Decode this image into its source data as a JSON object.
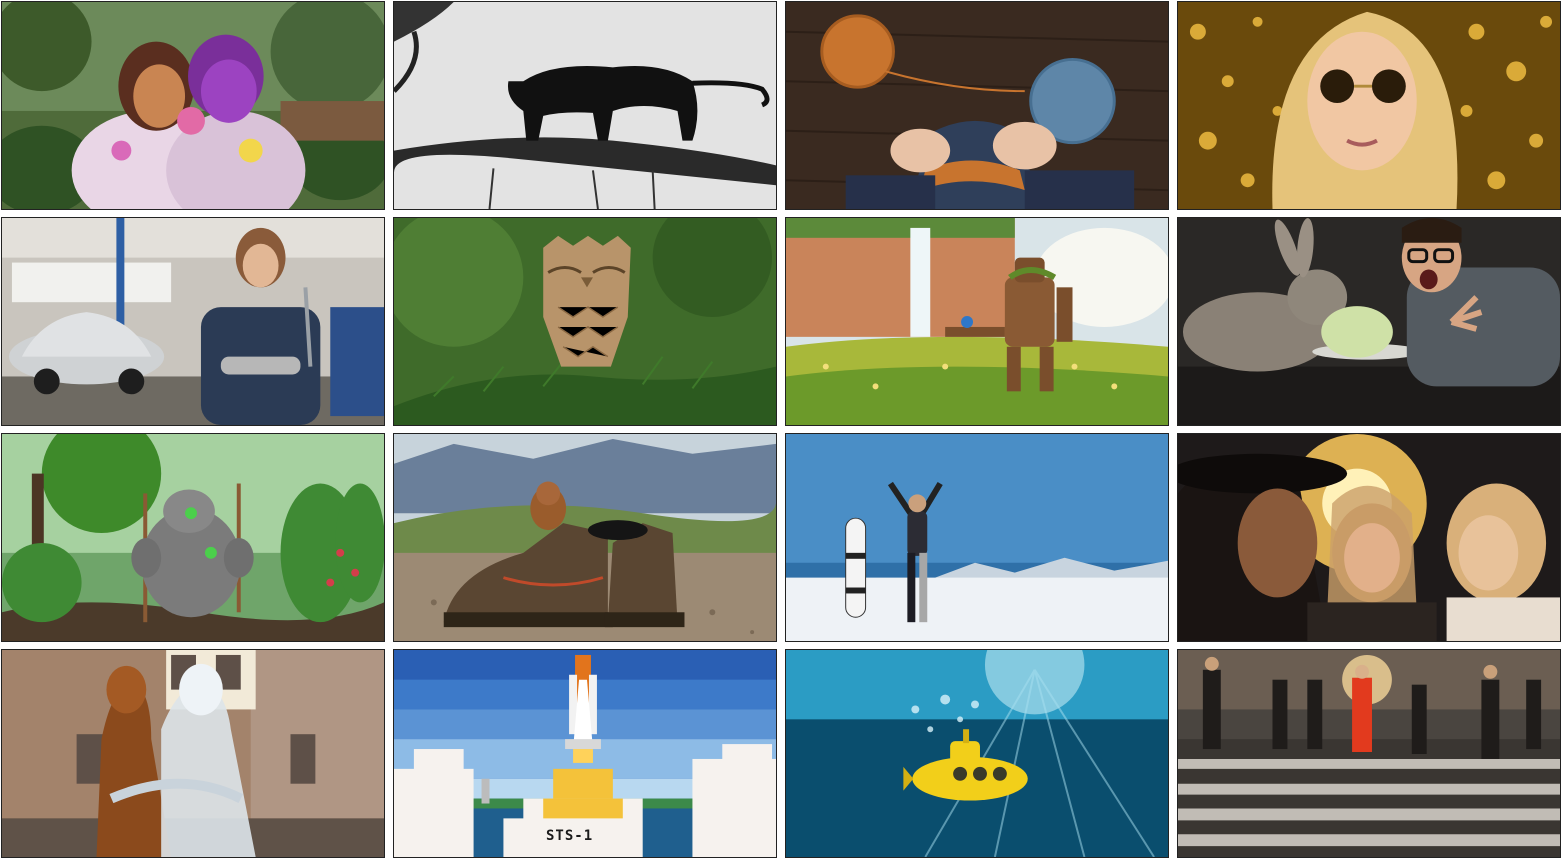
{
  "gallery": {
    "tiles": [
      {
        "subject": "two-women-holi-powder"
      },
      {
        "subject": "panther-on-branch-sketch"
      },
      {
        "subject": "knitting-hands-yarn-balls"
      },
      {
        "subject": "woman-sunglasses-golden-bokeh"
      },
      {
        "subject": "female-mechanic-garage-car"
      },
      {
        "subject": "origami-owl-pine-branch"
      },
      {
        "subject": "mossy-robot-waterfall-meadow"
      },
      {
        "subject": "rabbit-cabbage-surprised-man"
      },
      {
        "subject": "stone-golem-garden-tools"
      },
      {
        "subject": "squirrel-in-hiking-boots"
      },
      {
        "subject": "snowboarder-prosthetic-leg-cheering"
      },
      {
        "subject": "three-women-laughing-sunset"
      },
      {
        "subject": "wood-and-glass-figures-embrace"
      },
      {
        "subject": "pixel-space-shuttle-launch"
      },
      {
        "subject": "yellow-submarine-underwater"
      },
      {
        "subject": "pedestrians-crosswalk-sunset"
      }
    ],
    "shuttle_label": "STS-1"
  }
}
